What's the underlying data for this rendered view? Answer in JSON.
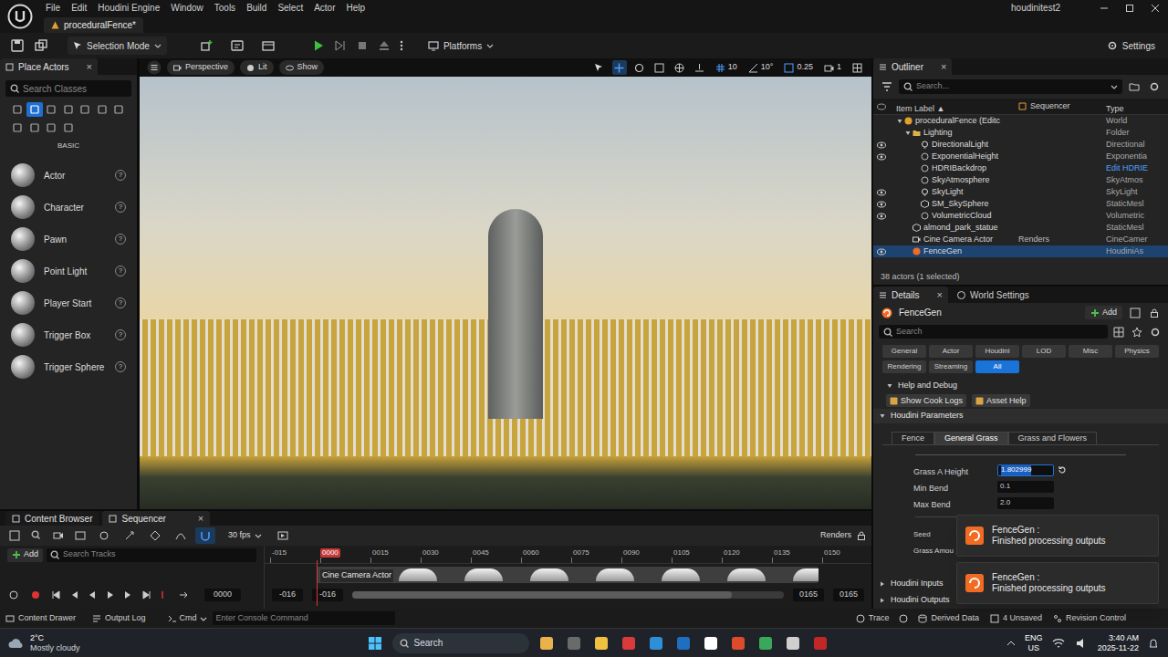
{
  "app": {
    "menus": [
      "File",
      "Edit",
      "Houdini Engine",
      "Window",
      "Tools",
      "Build",
      "Select",
      "Actor",
      "Help"
    ],
    "project": "houdinitest2",
    "document_tab": "proceduralFence*"
  },
  "toolbar": {
    "mode": "Selection Mode",
    "platforms": "Platforms",
    "settings": "Settings"
  },
  "place_actors": {
    "title": "Place Actors",
    "close": "×",
    "search_placeholder": "Search Classes",
    "category_icons": [
      {
        "selected": false
      },
      {
        "selected": true
      },
      {
        "selected": false
      },
      {
        "selected": false
      },
      {
        "selected": false
      },
      {
        "selected": false
      },
      {
        "selected": false
      },
      {
        "selected": false
      },
      {
        "selected": false
      },
      {
        "selected": false
      },
      {
        "selected": false
      }
    ],
    "category": "BASIC",
    "items": [
      {
        "label": "Actor",
        "help": "?"
      },
      {
        "label": "Character",
        "help": "?"
      },
      {
        "label": "Pawn",
        "help": "?"
      },
      {
        "label": "Point Light",
        "help": "?"
      },
      {
        "label": "Player Start",
        "help": "?"
      },
      {
        "label": "Trigger Box",
        "help": "?"
      },
      {
        "label": "Trigger Sphere",
        "help": "?"
      }
    ]
  },
  "viewport": {
    "perspective": "Perspective",
    "lit": "Lit",
    "show": "Show",
    "grid_size": "10",
    "angle": "10°",
    "scale": "0.25",
    "camera_speed": "1"
  },
  "outliner": {
    "title": "Outliner",
    "close": "×",
    "search_placeholder": "Search...",
    "columns": [
      "Item Label ▲",
      "Sequencer",
      "Type"
    ],
    "rows": [
      {
        "label": "proceduralFence (Editc",
        "type": "World",
        "depth": 0,
        "visible": false,
        "selected": false,
        "kind": "world",
        "expanded": true,
        "type_link": false
      },
      {
        "label": "Lighting",
        "type": "Folder",
        "depth": 1,
        "visible": false,
        "selected": false,
        "kind": "folder",
        "expanded": true,
        "type_link": false
      },
      {
        "label": "DirectionalLight",
        "type": "Directional",
        "depth": 2,
        "visible": true,
        "selected": false,
        "kind": "light",
        "type_link": false
      },
      {
        "label": "ExponentialHeight",
        "type": "Exponentia",
        "depth": 2,
        "visible": true,
        "selected": false,
        "kind": "actor",
        "type_link": false
      },
      {
        "label": "HDRIBackdrop",
        "type": "Edit HDRIE",
        "depth": 2,
        "visible": false,
        "selected": false,
        "kind": "actor",
        "type_link": true
      },
      {
        "label": "SkyAtmosphere",
        "type": "SkyAtmos",
        "depth": 2,
        "visible": false,
        "selected": false,
        "kind": "actor",
        "type_link": false
      },
      {
        "label": "SkyLight",
        "type": "SkyLight",
        "depth": 2,
        "visible": true,
        "selected": false,
        "kind": "light",
        "type_link": false
      },
      {
        "label": "SM_SkySphere",
        "type": "StaticMesl",
        "depth": 2,
        "visible": true,
        "selected": false,
        "kind": "mesh",
        "type_link": false
      },
      {
        "label": "VolumetricCloud",
        "type": "Volumetric",
        "depth": 2,
        "visible": true,
        "selected": false,
        "kind": "actor",
        "type_link": false
      },
      {
        "label": "almond_park_statue",
        "type": "StaticMesl",
        "depth": 1,
        "visible": false,
        "selected": false,
        "kind": "mesh",
        "type_link": false
      },
      {
        "label": "Cine Camera Actor",
        "sequencer": "Renders",
        "type": "CineCamer",
        "depth": 1,
        "visible": false,
        "selected": false,
        "kind": "camera",
        "type_link": false
      },
      {
        "label": "FenceGen",
        "type": "HoudiniAs",
        "depth": 1,
        "visible": true,
        "selected": true,
        "kind": "houdini",
        "type_link": false
      }
    ],
    "footer": "38 actors (1 selected)"
  },
  "details": {
    "title": "Details",
    "close": "×",
    "world_settings": "World Settings",
    "actor_name": "FenceGen",
    "add": "Add",
    "search_placeholder": "Search",
    "filters": [
      {
        "label": "General",
        "selected": false
      },
      {
        "label": "Actor",
        "selected": false
      },
      {
        "label": "Houdini",
        "selected": false
      },
      {
        "label": "LOD",
        "selected": false
      },
      {
        "label": "Misc",
        "selected": false
      },
      {
        "label": "Physics",
        "selected": false
      },
      {
        "label": "Rendering",
        "selected": false
      },
      {
        "label": "Streaming",
        "selected": false
      },
      {
        "label": "All",
        "selected": true
      }
    ],
    "help_section": "Help and Debug",
    "help_buttons": [
      "Show Cook Logs",
      "Asset Help"
    ],
    "params_section": "Houdini Parameters",
    "param_tabs": [
      {
        "label": "Fence",
        "selected": false
      },
      {
        "label": "General Grass",
        "selected": true
      },
      {
        "label": "Grass and Flowers",
        "selected": false
      }
    ],
    "params": [
      {
        "label": "Grass A Height",
        "value": "1.802999",
        "editing": true
      },
      {
        "label": "Min Bend",
        "value": "0.1",
        "editing": false
      },
      {
        "label": "Max Bend",
        "value": "2.0",
        "editing": false
      }
    ],
    "params2": [
      {
        "label": "Seed"
      },
      {
        "label": "Grass Amou"
      }
    ],
    "sections": [
      "Houdini Inputs",
      "Houdini Outputs"
    ]
  },
  "sequencer": {
    "tabs": [
      {
        "label": "Content Browser",
        "selected": false
      },
      {
        "label": "Sequencer",
        "selected": true
      }
    ],
    "close": "×",
    "fps": "30 fps",
    "renders": "Renders",
    "add": "Add",
    "search_placeholder": "Search Tracks",
    "ticks": [
      {
        "label": "-015",
        "current": false
      },
      {
        "label": "0000",
        "current": true
      },
      {
        "label": "0015",
        "current": false
      },
      {
        "label": "0030",
        "current": false
      },
      {
        "label": "0045",
        "current": false
      },
      {
        "label": "0060",
        "current": false
      },
      {
        "label": "0075",
        "current": false
      },
      {
        "label": "0090",
        "current": false
      },
      {
        "label": "0105",
        "current": false
      },
      {
        "label": "0120",
        "current": false
      },
      {
        "label": "0135",
        "current": false
      },
      {
        "label": "0150",
        "current": false
      }
    ],
    "track": "Cine Camera Actor",
    "current_frame": "0000",
    "range_start": "-016",
    "view_start": "-016",
    "view_end": "0165",
    "range_end": "0165"
  },
  "status_bar": {
    "content_drawer": "Content Drawer",
    "output_log": "Output Log",
    "cmd": "Cmd",
    "console_placeholder": "Enter Console Command",
    "trace": "Trace",
    "derived_data": "Derived Data",
    "unsaved": "4 Unsaved",
    "revision_control": "Revision Control"
  },
  "taskbar": {
    "temperature": "2°C",
    "weather": "Mostly cloudy",
    "search": "Search",
    "language": "ENG",
    "region": "US",
    "time": "3:40 AM",
    "date": "2025-11-22"
  },
  "toasts": [
    {
      "title": "FenceGen :",
      "message": "Finished processing outputs"
    },
    {
      "title": "FenceGen :",
      "message": "Finished processing outputs"
    }
  ]
}
